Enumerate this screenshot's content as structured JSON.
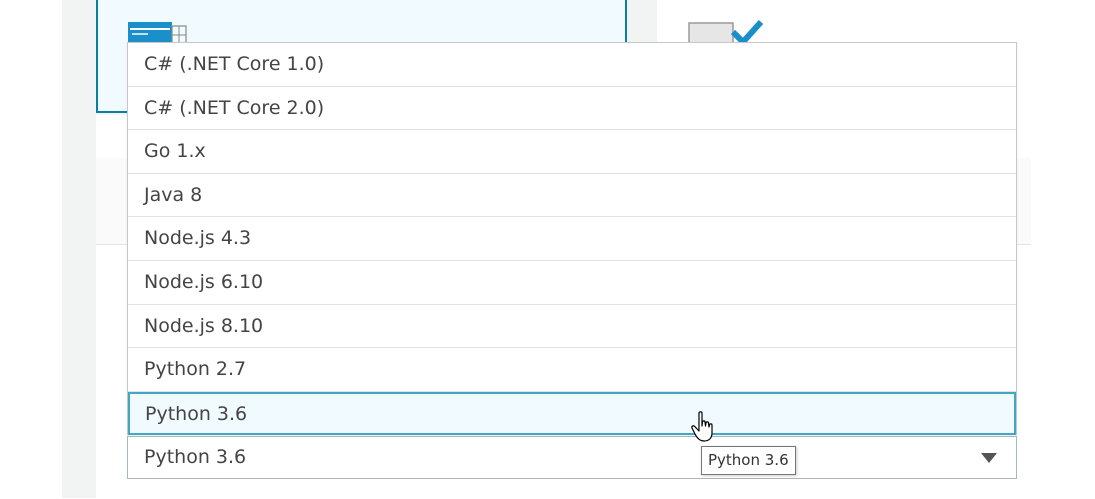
{
  "runtime_dropdown": {
    "options": [
      "C# (.NET Core 1.0)",
      "C# (.NET Core 2.0)",
      "Go 1.x",
      "Java 8",
      "Node.js 4.3",
      "Node.js 6.10",
      "Node.js 8.10",
      "Python 2.7",
      "Python 3.6"
    ],
    "hovered_option": "Python 3.6"
  },
  "runtime_select": {
    "value": "Python 3.6"
  },
  "tooltip": {
    "text": "Python 3.6"
  },
  "icons": {
    "card_1": "browser-window-icon",
    "card_2": "folder-check-icon",
    "cursor": "hand-pointer-icon",
    "caret": "triangle-down-icon"
  },
  "colors": {
    "accent": "#0a7ea4",
    "selected_bg": "#f1faff",
    "check": "#1a8fc9"
  }
}
